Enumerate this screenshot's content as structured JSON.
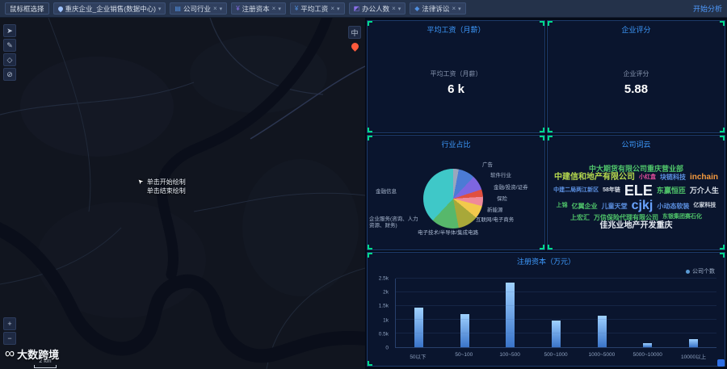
{
  "toolbar": {
    "select_tool_label": "鼠标框选择",
    "dataset_label": "重庆企业_企业销售(数据中心)",
    "filters": [
      {
        "label": "公司行业",
        "icon": "▤",
        "icon_color": "#4f8fe0"
      },
      {
        "label": "注册资本",
        "icon": "¥",
        "icon_color": "#8a6fe8"
      },
      {
        "label": "平均工资",
        "icon": "¥",
        "icon_color": "#4f8fe0"
      },
      {
        "label": "办公人数",
        "icon": "◩",
        "icon_color": "#8a6fe8"
      },
      {
        "label": "法律诉讼",
        "icon": "◆",
        "icon_color": "#4f8fe0"
      }
    ],
    "close_icon": "×",
    "caret_icon": "▾",
    "analyze_label": "开始分析"
  },
  "map": {
    "tools": [
      {
        "name": "select-tool",
        "glyph": "➤"
      },
      {
        "name": "draw-tool",
        "glyph": "✎"
      },
      {
        "name": "polygon-tool",
        "glyph": "◇"
      },
      {
        "name": "clear-tool",
        "glyph": "⊘"
      }
    ],
    "zoom_in": "+",
    "zoom_out": "−",
    "layer_toggle": "中",
    "draw_hint_line1": "单击开始绘制",
    "draw_hint_line2": "单击结束绘制",
    "scale_label": "2 km",
    "brand_icon": "∞",
    "brand": "大数跨境"
  },
  "panels": {
    "salary": {
      "title": "平均工资（月薪）",
      "metric_label": "平均工资（月薪）",
      "metric_value": "6 k"
    },
    "score": {
      "title": "企业评分",
      "metric_label": "企业评分",
      "metric_value": "5.88"
    },
    "industry": {
      "title": "行业占比"
    },
    "wordcloud": {
      "title": "公司词云",
      "words": [
        {
          "text": "中大期货有限公司重庆营业部",
          "color": "#4fc46a",
          "size": 9
        },
        {
          "text": "中建信和地产有限公司",
          "color": "#b5d94e",
          "size": 10
        },
        {
          "text": "小红盒",
          "color": "#e84f9e",
          "size": 7
        },
        {
          "text": "块链科技",
          "color": "#5b8fe0",
          "size": 8
        },
        {
          "text": "inchain",
          "color": "#f59a3e",
          "size": 10
        },
        {
          "text": "中建二局两江新区",
          "color": "#5b8fe0",
          "size": 7
        },
        {
          "text": "58年链",
          "color": "#d9dfe8",
          "size": 7
        },
        {
          "text": "ELE",
          "color": "#eef2f8",
          "size": 18
        },
        {
          "text": "东赢恒匝",
          "color": "#4fc46a",
          "size": 9
        },
        {
          "text": "万介人生",
          "color": "#d9dfe8",
          "size": 9
        },
        {
          "text": "上锦",
          "color": "#4fc46a",
          "size": 7
        },
        {
          "text": "亿翼企业",
          "color": "#4fc46a",
          "size": 8
        },
        {
          "text": "儿童天堂",
          "color": "#5b8fe0",
          "size": 8
        },
        {
          "text": "cjkj",
          "color": "#6aa4ff",
          "size": 16
        },
        {
          "text": "小动态软装",
          "color": "#5b8fe0",
          "size": 8
        },
        {
          "text": "亿家科技",
          "color": "#d9dfe8",
          "size": 7
        },
        {
          "text": "上宏汇",
          "color": "#4fc46a",
          "size": 8
        },
        {
          "text": "万信保险代理有限公司",
          "color": "#4fc46a",
          "size": 8
        },
        {
          "text": "东银集团赛石化",
          "color": "#4fc46a",
          "size": 7
        },
        {
          "text": "佳兆业地产开发重庆",
          "color": "#e6ebf2",
          "size": 10
        }
      ]
    },
    "capital": {
      "title": "注册资本（万元）",
      "legend_label": "公司个数"
    }
  },
  "chart_data": [
    {
      "type": "pie",
      "title": "行业占比",
      "legend_position": "none",
      "slices": [
        {
          "label": "广告",
          "value": 3,
          "color": "#9aa7bd"
        },
        {
          "label": "软件行业",
          "value": 9,
          "color": "#4b7bd5"
        },
        {
          "label": "金融/投资/证券",
          "value": 8,
          "color": "#7e66e0"
        },
        {
          "label": "保险",
          "value": 4,
          "color": "#e0503f"
        },
        {
          "label": "新能源",
          "value": 5,
          "color": "#ef8a9a"
        },
        {
          "label": "互联网/电子商务",
          "value": 7,
          "color": "#f2c94c"
        },
        {
          "label": "电子技术/半导体/集成电路",
          "value": 11,
          "color": "#a8a839"
        },
        {
          "label": "企业服务(咨询、人力资源、财务)",
          "value": 15,
          "color": "#57b86b"
        },
        {
          "label": "金融信息",
          "value": 38,
          "color": "#3fc8c8"
        }
      ]
    },
    {
      "type": "bar",
      "title": "注册资本（万元）",
      "legend": [
        "公司个数"
      ],
      "legend_position": "top-right",
      "categories": [
        "50以下",
        "50~100",
        "100~500",
        "500~1000",
        "1000~5000",
        "5000~10000",
        "10000以上"
      ],
      "values": [
        1450,
        1200,
        2350,
        980,
        1150,
        150,
        300
      ],
      "xlabel": "",
      "ylabel": "",
      "ylim": [
        0,
        2500
      ],
      "yticks": [
        "0",
        "0.5k",
        "1k",
        "1.5k",
        "2k",
        "2.5k"
      ],
      "bar_color": "#5b9bd5",
      "grid": true
    }
  ]
}
